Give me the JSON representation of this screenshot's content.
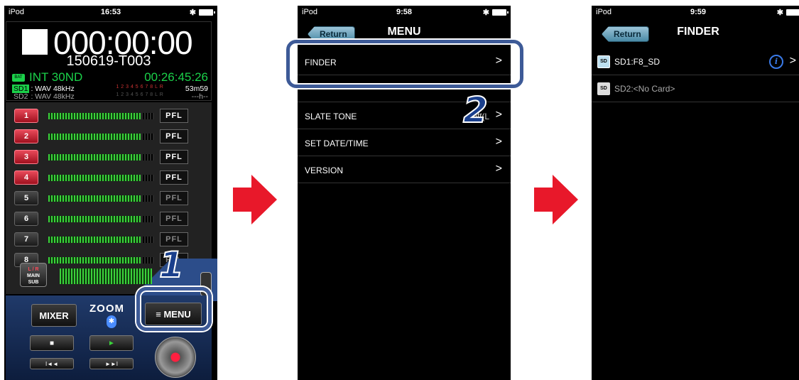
{
  "status_bars": [
    {
      "device": "iPod",
      "time": "16:53"
    },
    {
      "device": "iPod",
      "time": "9:58"
    },
    {
      "device": "iPod",
      "time": "9:59"
    }
  ],
  "screen1": {
    "timecode": "000:00:00",
    "take_name": "150619-T003",
    "power_source": "INT 30ND",
    "battery_label": "BAT",
    "remaining_time": "00:26:45:26",
    "sd1": {
      "tag": "SD1",
      "format": ": WAV 48kHz",
      "slots": "1 2 3 4 5 6 7 8 L R",
      "remaining": "53m59"
    },
    "sd2": {
      "tag": "SD2",
      "format": ": WAV 48kHz",
      "slots": "1 2 3 4 5 6 7 8 L R",
      "remaining": "---h--"
    },
    "channels": [
      {
        "label": "1",
        "armed": true,
        "pfl": "PFL"
      },
      {
        "label": "2",
        "armed": true,
        "pfl": "PFL"
      },
      {
        "label": "3",
        "armed": true,
        "pfl": "PFL"
      },
      {
        "label": "4",
        "armed": true,
        "pfl": "PFL"
      },
      {
        "label": "5",
        "armed": false,
        "pfl": "PFL"
      },
      {
        "label": "6",
        "armed": false,
        "pfl": "PFL"
      },
      {
        "label": "7",
        "armed": false,
        "pfl": "PFL"
      },
      {
        "label": "8",
        "armed": false,
        "pfl": "PFL"
      }
    ],
    "lr_button": {
      "top": "L / R",
      "mid": "MAIN",
      "bottom": "SUB"
    },
    "mixer_label": "MIXER",
    "brand_logo": "ZOOM",
    "menu_label": "≡ MENU",
    "transport": {
      "stop": "■",
      "play": "►",
      "rewind": "I◄◄",
      "forward": "►►I"
    }
  },
  "screen2": {
    "return_label": "Return",
    "title": "MENU",
    "items": [
      {
        "label": "FINDER",
        "value": ""
      },
      {
        "label": "",
        "value": ""
      },
      {
        "label": "SLATE TONE",
        "value": "Off(L"
      },
      {
        "label": "SET DATE/TIME",
        "value": ""
      },
      {
        "label": "VERSION",
        "value": ""
      }
    ]
  },
  "screen3": {
    "return_label": "Return",
    "title": "FINDER",
    "items": [
      {
        "label": "SD1:F8_SD",
        "icon": "SD"
      },
      {
        "label": "SD2:<No Card>",
        "icon": "SD"
      }
    ]
  },
  "callouts": {
    "step1": "1",
    "step2": "2"
  },
  "colors": {
    "arrow": "#e8182a",
    "callout": "#3d5a97",
    "accent_green": "#1bd14a",
    "armed_red": "#d92a3a"
  }
}
